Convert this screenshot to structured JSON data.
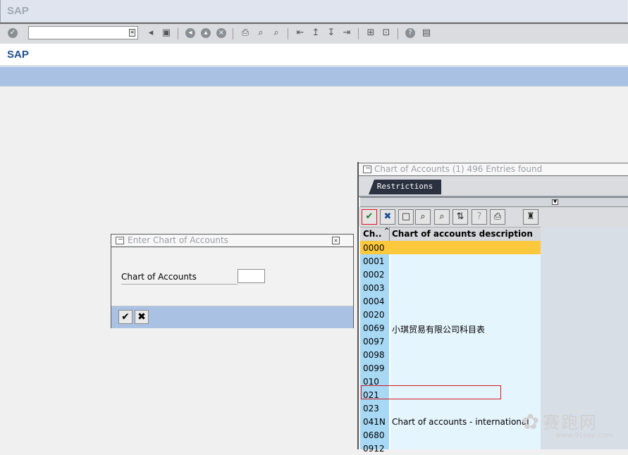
{
  "window": {
    "title": "SAP"
  },
  "system_toolbar": {
    "command_field_value": "",
    "icons": [
      "enter-icon",
      "back-icon",
      "save-icon",
      "back-nav-icon",
      "exit-icon",
      "cancel-icon",
      "print-icon",
      "find-icon",
      "find-next-icon",
      "first-page-icon",
      "prev-page-icon",
      "next-page-icon",
      "last-page-icon",
      "new-session-icon",
      "shortcut-icon",
      "help-icon",
      "layout-menu-icon"
    ]
  },
  "app_header": {
    "title": "SAP"
  },
  "dialog": {
    "title": "Enter Chart of Accounts",
    "field_label": "Chart of Accounts",
    "field_value": ""
  },
  "popup": {
    "title": "Chart of Accounts (1)  496 Entries found",
    "tab_label": "Restrictions",
    "columns": [
      "Ch..",
      "Chart of accounts description"
    ],
    "rows": [
      {
        "key": "0000",
        "desc": ""
      },
      {
        "key": "0001",
        "desc": ""
      },
      {
        "key": "0002",
        "desc": ""
      },
      {
        "key": "0003",
        "desc": ""
      },
      {
        "key": "0004",
        "desc": ""
      },
      {
        "key": "0020",
        "desc": ""
      },
      {
        "key": "0069",
        "desc": "小琪贸易有限公司科目表"
      },
      {
        "key": "0097",
        "desc": ""
      },
      {
        "key": "0098",
        "desc": ""
      },
      {
        "key": "0099",
        "desc": ""
      },
      {
        "key": "010",
        "desc": ""
      },
      {
        "key": "021",
        "desc": ""
      },
      {
        "key": "023",
        "desc": ""
      },
      {
        "key": "041N",
        "desc": "Chart of accounts - international"
      },
      {
        "key": "0680",
        "desc": ""
      },
      {
        "key": "0912",
        "desc": ""
      }
    ]
  },
  "watermark": {
    "text": "赛跑网",
    "url": "www.91sap.com"
  },
  "colors": {
    "accent": "#a9c2e4",
    "selected_row": "#fdc83c",
    "highlight_border": "#d11a22"
  }
}
